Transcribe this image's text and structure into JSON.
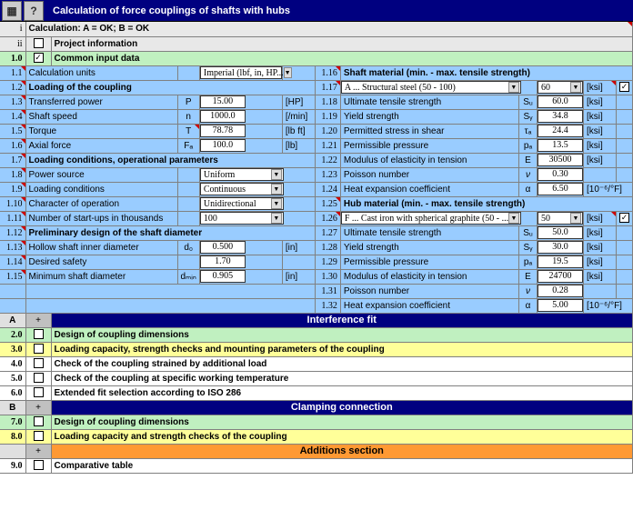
{
  "header": {
    "title": "Calculation of force couplings of shafts with hubs"
  },
  "row_i": {
    "label": "Calculation:   A = OK;   B = OK"
  },
  "row_ii": {
    "label": "Project information"
  },
  "r1_0": {
    "label": "Common input data"
  },
  "r1_1": {
    "label": "Calculation units",
    "select": "Imperial (lbf, in, HP..."
  },
  "r1_16": {
    "label": "Shaft material (min. - max. tensile strength)"
  },
  "r1_2": {
    "label": "Loading of the coupling"
  },
  "r1_17": {
    "select": "A ... Structural steel  (50 - 100)",
    "val": "60",
    "unit": "[ksi]"
  },
  "r1_3": {
    "label": "Transferred power",
    "sym": "P",
    "val": "15.00",
    "unit": "[HP]"
  },
  "r1_18": {
    "label": "Ultimate tensile strength",
    "sym": "Sᵤ",
    "val": "60.0",
    "unit": "[ksi]"
  },
  "r1_4": {
    "label": "Shaft speed",
    "sym": "n",
    "val": "1000.0",
    "unit": "[/min]"
  },
  "r1_19": {
    "label": "Yield strength",
    "sym": "Sᵧ",
    "val": "34.8",
    "unit": "[ksi]"
  },
  "r1_5": {
    "label": "Torque",
    "sym": "T",
    "val": "78.78",
    "unit": "[lb ft]"
  },
  "r1_20": {
    "label": "Permitted stress in shear",
    "sym": "τₐ",
    "val": "24.4",
    "unit": "[ksi]"
  },
  "r1_6": {
    "label": "Axial force",
    "sym": "Fₐ",
    "val": "100.0",
    "unit": "[lb]"
  },
  "r1_21": {
    "label": "Permissible pressure",
    "sym": "pₐ",
    "val": "13.5",
    "unit": "[ksi]"
  },
  "r1_7": {
    "label": "Loading conditions, operational parameters"
  },
  "r1_22": {
    "label": "Modulus of elasticity in tension",
    "sym": "E",
    "val": "30500",
    "unit": "[ksi]"
  },
  "r1_8": {
    "label": "Power source",
    "select": "Uniform"
  },
  "r1_23": {
    "label": "Poisson number",
    "sym": "ν",
    "val": "0.30"
  },
  "r1_9": {
    "label": "Loading conditions",
    "select": "Continuous"
  },
  "r1_24": {
    "label": "Heat expansion coefficient",
    "sym": "α",
    "val": "6.50",
    "unit": "[10⁻⁶/°F]"
  },
  "r1_10": {
    "label": "Character of operation",
    "select": "Unidirectional"
  },
  "r1_25": {
    "label": "Hub material (min. - max. tensile strength)"
  },
  "r1_11": {
    "label": "Number of start-ups in thousands",
    "select": "100"
  },
  "r1_26": {
    "select": "F ... Cast iron with spherical graphite  (50 - ...",
    "val": "50",
    "unit": "[ksi]"
  },
  "r1_12": {
    "label": "Preliminary design of the shaft diameter"
  },
  "r1_27": {
    "label": "Ultimate tensile strength",
    "sym": "Sᵤ",
    "val": "50.0",
    "unit": "[ksi]"
  },
  "r1_13": {
    "label": "Hollow shaft inner diameter",
    "sym": "d₀",
    "val": "0.500",
    "unit": "[in]"
  },
  "r1_28": {
    "label": "Yield strength",
    "sym": "Sᵧ",
    "val": "30.0",
    "unit": "[ksi]"
  },
  "r1_14": {
    "label": "Desired safety",
    "val": "1.70"
  },
  "r1_29": {
    "label": "Permissible pressure",
    "sym": "pₐ",
    "val": "19.5",
    "unit": "[ksi]"
  },
  "r1_15": {
    "label": "Minimum shaft diameter",
    "sym": "dₘᵢₙ",
    "val": "0.905",
    "unit": "[in]"
  },
  "r1_30": {
    "label": "Modulus of elasticity in tension",
    "sym": "E",
    "val": "24700",
    "unit": "[ksi]"
  },
  "r1_31": {
    "label": "Poisson number",
    "sym": "ν",
    "val": "0.28"
  },
  "r1_32": {
    "label": "Heat expansion coefficient",
    "sym": "α",
    "val": "5.00",
    "unit": "[10⁻⁶/°F]"
  },
  "secA": {
    "title": "Interference fit"
  },
  "r2_0": {
    "label": "Design of coupling dimensions"
  },
  "r3_0": {
    "label": "Loading capacity, strength checks and mounting parameters of the coupling"
  },
  "r4_0": {
    "label": "Check of the coupling strained by additional load"
  },
  "r5_0": {
    "label": "Check of the coupling at specific working temperature"
  },
  "r6_0": {
    "label": "Extended fit selection according to ISO 286"
  },
  "secB": {
    "title": "Clamping connection"
  },
  "r7_0": {
    "label": "Design of coupling dimensions"
  },
  "r8_0": {
    "label": "Loading capacity and strength checks of the coupling"
  },
  "secAdd": {
    "title": "Additions section"
  },
  "r9_0": {
    "label": "Comparative table"
  }
}
